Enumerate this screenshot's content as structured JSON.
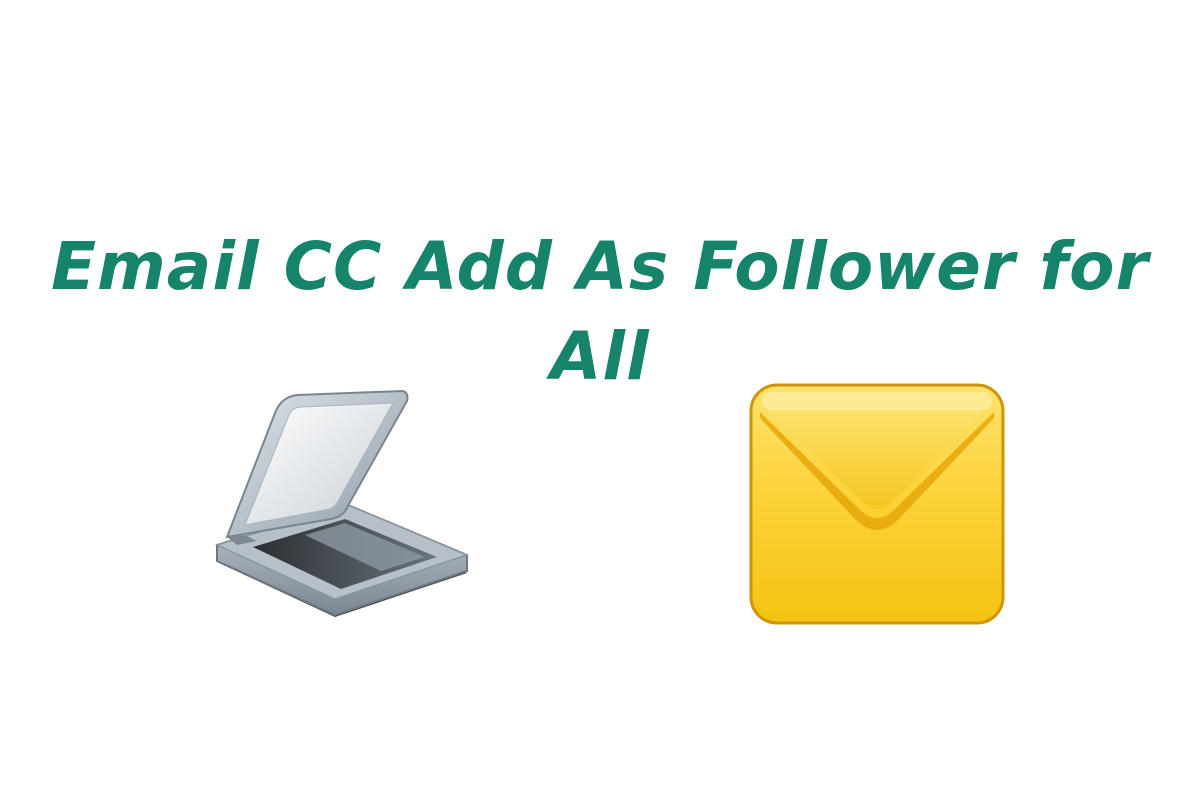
{
  "header": {
    "title": "Email CC Add As Follower for All"
  },
  "icons": {
    "left": "scanner-icon",
    "right": "envelope-icon"
  },
  "colors": {
    "title": "#15846a",
    "envelope_body": "#f7c615",
    "envelope_border": "#d39a08",
    "scanner_body": "#8e9aa6",
    "scanner_lid": "#b9c3cc"
  }
}
